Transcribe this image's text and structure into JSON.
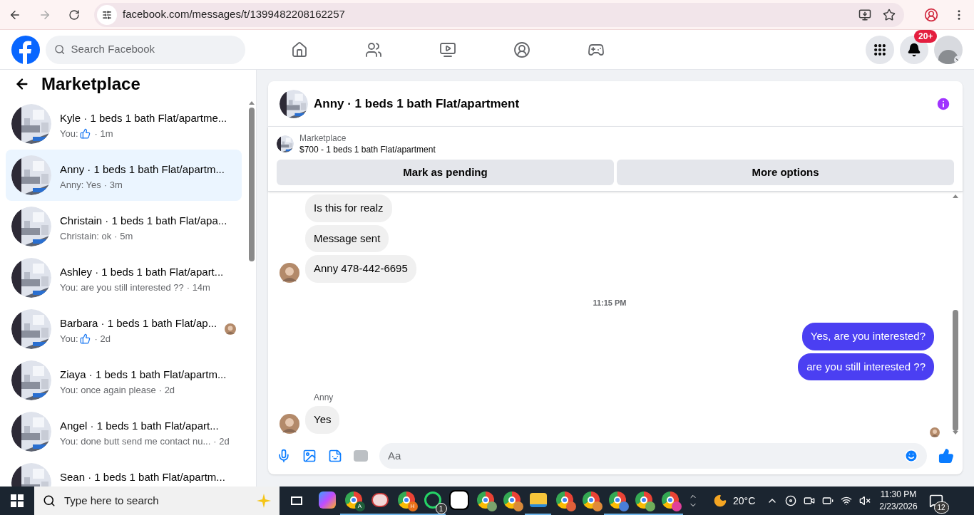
{
  "browser": {
    "url": "facebook.com/messages/t/1399482208162257"
  },
  "topbar": {
    "search_placeholder": "Search Facebook",
    "notification_badge": "20+"
  },
  "sidebar": {
    "title": "Marketplace",
    "conversations": [
      {
        "name": "Kyle · 1 beds 1 bath Flat/apartme...",
        "preview": {
          "kind": "like",
          "text": "You:"
        },
        "time": "· 1m",
        "selected": false,
        "seen": false
      },
      {
        "name": "Anny · 1 beds 1 bath Flat/apartm...",
        "preview": {
          "kind": "text",
          "text": "Anny: Yes"
        },
        "time": "· 3m",
        "selected": true,
        "seen": false
      },
      {
        "name": "Christain · 1 beds 1 bath Flat/apa...",
        "preview": {
          "kind": "text",
          "text": "Christain: ok"
        },
        "time": "· 5m",
        "selected": false,
        "seen": false
      },
      {
        "name": "Ashley · 1 beds 1 bath Flat/apart...",
        "preview": {
          "kind": "text",
          "text": "You: are you still interested ??"
        },
        "time": "· 14m",
        "selected": false,
        "seen": false
      },
      {
        "name": "Barbara · 1 beds 1 bath Flat/ap...",
        "preview": {
          "kind": "like",
          "text": "You:"
        },
        "time": "· 2d",
        "selected": false,
        "seen": true
      },
      {
        "name": "Ziaya · 1 beds 1 bath Flat/apartm...",
        "preview": {
          "kind": "text",
          "text": "You: once again please"
        },
        "time": "· 2d",
        "selected": false,
        "seen": false
      },
      {
        "name": "Angel · 1 beds 1 bath Flat/apart...",
        "preview": {
          "kind": "text",
          "text": "You: done butt send me contact nu..."
        },
        "time": "· 2d",
        "selected": false,
        "seen": false
      },
      {
        "name": "Sean · 1 beds 1 bath Flat/apartm...",
        "selected": false,
        "seen": false
      }
    ]
  },
  "chat": {
    "title": "Anny · 1 beds 1 bath Flat/apartment",
    "listing": {
      "source": "Marketplace",
      "title": "$700 - 1 beds 1 bath Flat/apartment"
    },
    "buttons": [
      "Mark as pending",
      "More options"
    ],
    "messages": [
      {
        "kind": "incoming",
        "text": "Is this for realz",
        "avatar": false
      },
      {
        "kind": "incoming",
        "text": "Message sent",
        "avatar": false
      },
      {
        "kind": "incoming",
        "text": "Anny 478-442-6695",
        "avatar": true
      },
      {
        "kind": "time",
        "text": "11:15 PM"
      },
      {
        "kind": "outgoing",
        "text": "Yes, are you interested?"
      },
      {
        "kind": "outgoing",
        "text": "are you still interested ??"
      },
      {
        "kind": "sender",
        "text": "Anny"
      },
      {
        "kind": "incoming",
        "text": "Yes",
        "avatar": true
      }
    ],
    "composer_placeholder": "Aa"
  },
  "taskbar": {
    "search_placeholder": "Type here to search",
    "apps": [
      {
        "kind": "copilot",
        "active": false
      },
      {
        "kind": "chrome",
        "badge": "A",
        "color": "#1e5e3a",
        "active": true
      },
      {
        "kind": "paint",
        "active": true
      },
      {
        "kind": "chrome",
        "badge": "H",
        "color": "#e8711a",
        "active": true
      },
      {
        "kind": "whatsapp",
        "badge": "1",
        "active": true
      },
      {
        "kind": "capcut",
        "active": false
      },
      {
        "kind": "chrome",
        "color": "#7aa36d",
        "active": false
      },
      {
        "kind": "chrome",
        "color": "#d98a3a",
        "active": false
      },
      {
        "kind": "files",
        "active": true
      },
      {
        "kind": "chrome",
        "color": "#e0603a",
        "active": false
      },
      {
        "kind": "chrome",
        "color": "#e08a3a",
        "active": false
      },
      {
        "kind": "chrome",
        "color": "#4a7fd8",
        "active": true
      },
      {
        "kind": "chrome",
        "color": "#6fae5a",
        "active": true
      },
      {
        "kind": "chrome",
        "color": "#e0409a",
        "active": true
      }
    ],
    "temperature": "20°C",
    "time": "11:30 PM",
    "date": "2/23/2026",
    "notifications": "12"
  }
}
